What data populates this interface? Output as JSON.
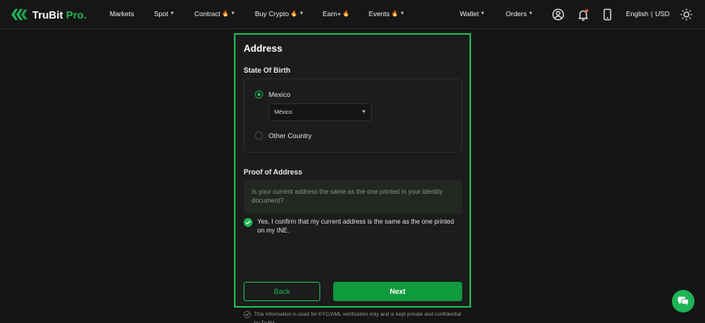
{
  "brand": {
    "name": "TruBit",
    "suffix": "Pro.",
    "color": "#1fb455"
  },
  "nav": {
    "markets": "Markets",
    "spot": "Spot",
    "contract": "Contract",
    "buy_crypto": "Buy Crypto",
    "earn": "Earn+",
    "events": "Events",
    "wallet": "Wallet",
    "orders": "Orders",
    "language": "English",
    "separator": "|",
    "currency": "USD"
  },
  "icons": {
    "profile": "user-circle-icon",
    "notifications": "bell-icon",
    "device": "phone-icon",
    "theme": "sun-icon"
  },
  "form": {
    "title": "Address",
    "state_of_birth_label": "State Of Birth",
    "options": [
      {
        "label": "Mexico",
        "checked": true
      },
      {
        "label": "Other Country",
        "checked": false
      }
    ],
    "state_select_value": "México",
    "proof_label": "Proof of Address",
    "question": "Is your current address the same as the one printed in your identity document?",
    "confirm_text": "Yes, I confirm that my current address is the same as the one printed on my INE.",
    "back_label": "Back",
    "next_label": "Next"
  },
  "footer": {
    "note": "This information is used for KYC/AML verification only and is kept private and confidential by TruBit."
  },
  "colors": {
    "accent": "#1fb455",
    "next_button": "#0f9a3b",
    "background": "#151515",
    "flame": "#ff6a2a"
  }
}
